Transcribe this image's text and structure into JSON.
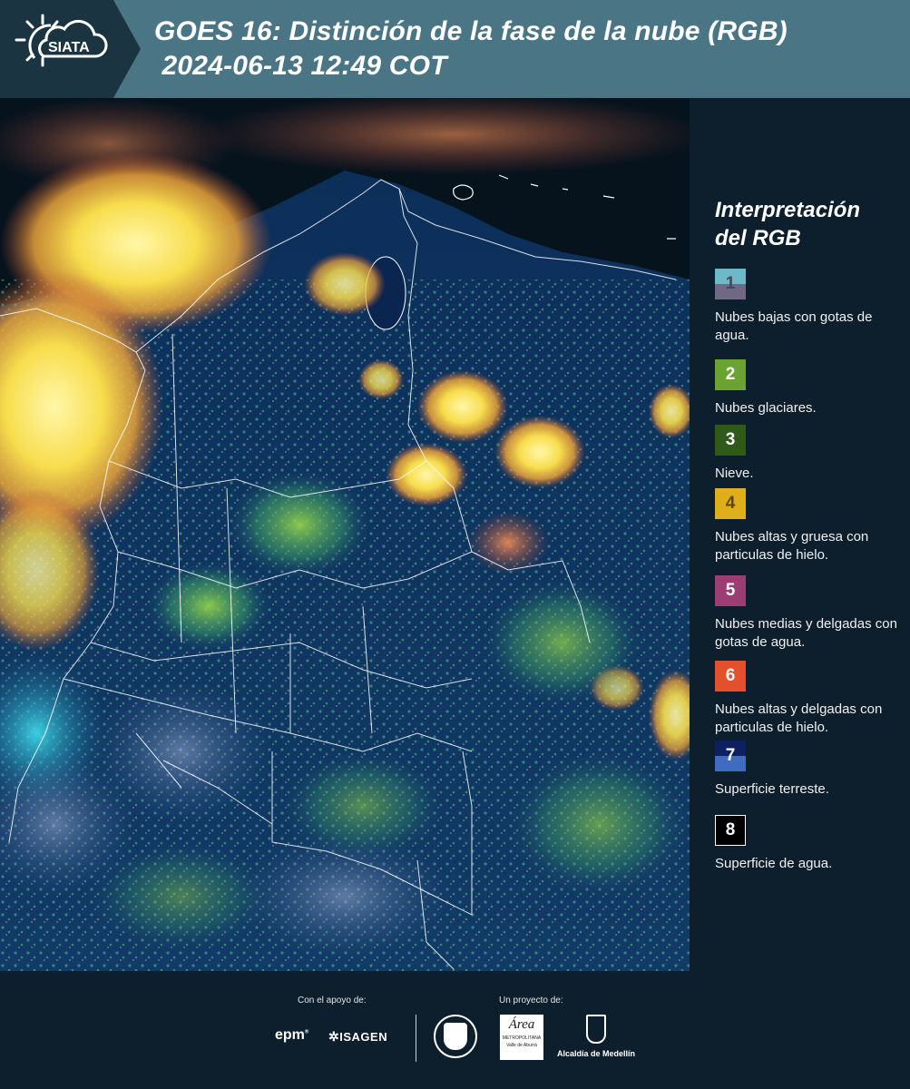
{
  "header": {
    "logo_text": "SIATA",
    "title_line1": "GOES 16: Distinción de la fase de la nube (RGB)",
    "title_line2": " 2024-06-13 12:49 COT",
    "background_color": "#4a7585"
  },
  "legend": {
    "title_line1": "Interpretación",
    "title_line2": "del RGB",
    "items": [
      {
        "number": "1",
        "label": "Nubes bajas con gotas de agua.",
        "color_top": "#6fb8c8",
        "color_bottom": "#6e6a86",
        "text_color": "#3f4a5a"
      },
      {
        "number": "2",
        "label": "Nubes glaciares.",
        "color_top": "#6aa331",
        "color_bottom": "#6aa331",
        "text_color": "#ffffff"
      },
      {
        "number": "3",
        "label": "Nieve.",
        "color_top": "#2f5a1c",
        "color_bottom": "#2f5a1c",
        "text_color": "#ffffff"
      },
      {
        "number": "4",
        "label": "Nubes altas y gruesa con particulas de hielo.",
        "color_top": "#dfae1b",
        "color_bottom": "#dfae1b",
        "text_color": "#5a4a10"
      },
      {
        "number": "5",
        "label": "Nubes medias y delgadas con gotas de agua.",
        "color_top": "#9c3d73",
        "color_bottom": "#9c3d73",
        "text_color": "#ffffff"
      },
      {
        "number": "6",
        "label": "Nubes altas y delgadas con particulas de hielo.",
        "color_top": "#e2502c",
        "color_bottom": "#e2502c",
        "text_color": "#ffffff"
      },
      {
        "number": "7",
        "label": "Superficie terreste.",
        "color_top": "#0d2160",
        "color_bottom": "#3f6cc2",
        "text_color": "#ffffff"
      },
      {
        "number": "8",
        "label": "Superficie de agua.",
        "color_top": "#000000",
        "color_bottom": "#000000",
        "text_color": "#ffffff"
      }
    ]
  },
  "footer": {
    "support_label": "Con el apoyo de:",
    "project_label": "Un proyecto de:",
    "epm_text": "epm",
    "isagen_text": "ISAGEN",
    "metro_text": "Área",
    "metro_sub1": "METROPOLITANA",
    "metro_sub2": "Valle de Aburrá",
    "alcaldia_text": "Alcaldía de Medellín"
  },
  "map": {
    "description_icon": "satellite-rgb-image"
  }
}
